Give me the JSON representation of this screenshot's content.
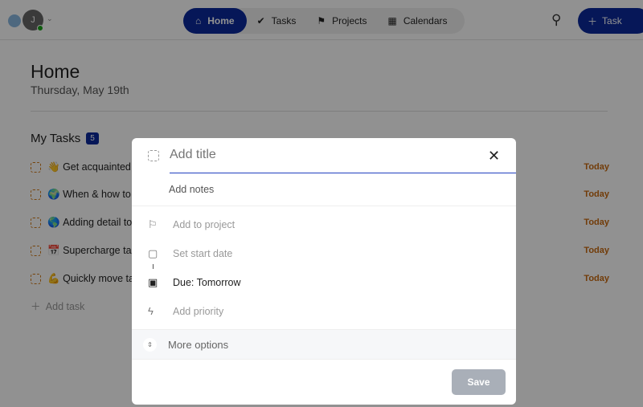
{
  "header": {
    "avatar_initial": "J",
    "nav": [
      {
        "label": "Home",
        "icon": "home-icon",
        "active": true
      },
      {
        "label": "Tasks",
        "icon": "double-check-icon"
      },
      {
        "label": "Projects",
        "icon": "flag-icon"
      },
      {
        "label": "Calendars",
        "icon": "calendar-icon"
      }
    ],
    "task_button": "Task"
  },
  "page": {
    "title": "Home",
    "date": "Thursday, May 19th",
    "section": "My Tasks",
    "count": "5",
    "tasks": [
      {
        "emoji": "👋",
        "title": "Get acquainted w",
        "due": "Today"
      },
      {
        "emoji": "🌍",
        "title": "When & how to c",
        "due": "Today"
      },
      {
        "emoji": "🌎",
        "title": "Adding detail to",
        "due": "Today"
      },
      {
        "emoji": "📅",
        "title": "Supercharge task",
        "due": "Today"
      },
      {
        "emoji": "💪",
        "title": "Quickly move tas",
        "due": "Today"
      }
    ],
    "add_task": "Add task"
  },
  "modal": {
    "title_placeholder": "Add title",
    "notes_placeholder": "Add notes",
    "project": "Add to project",
    "start": "Set start date",
    "due": "Due: Tomorrow",
    "priority": "Add priority",
    "more": "More options",
    "save": "Save"
  },
  "colors": {
    "primary": "#0b2a9c",
    "today": "#c86a10"
  }
}
